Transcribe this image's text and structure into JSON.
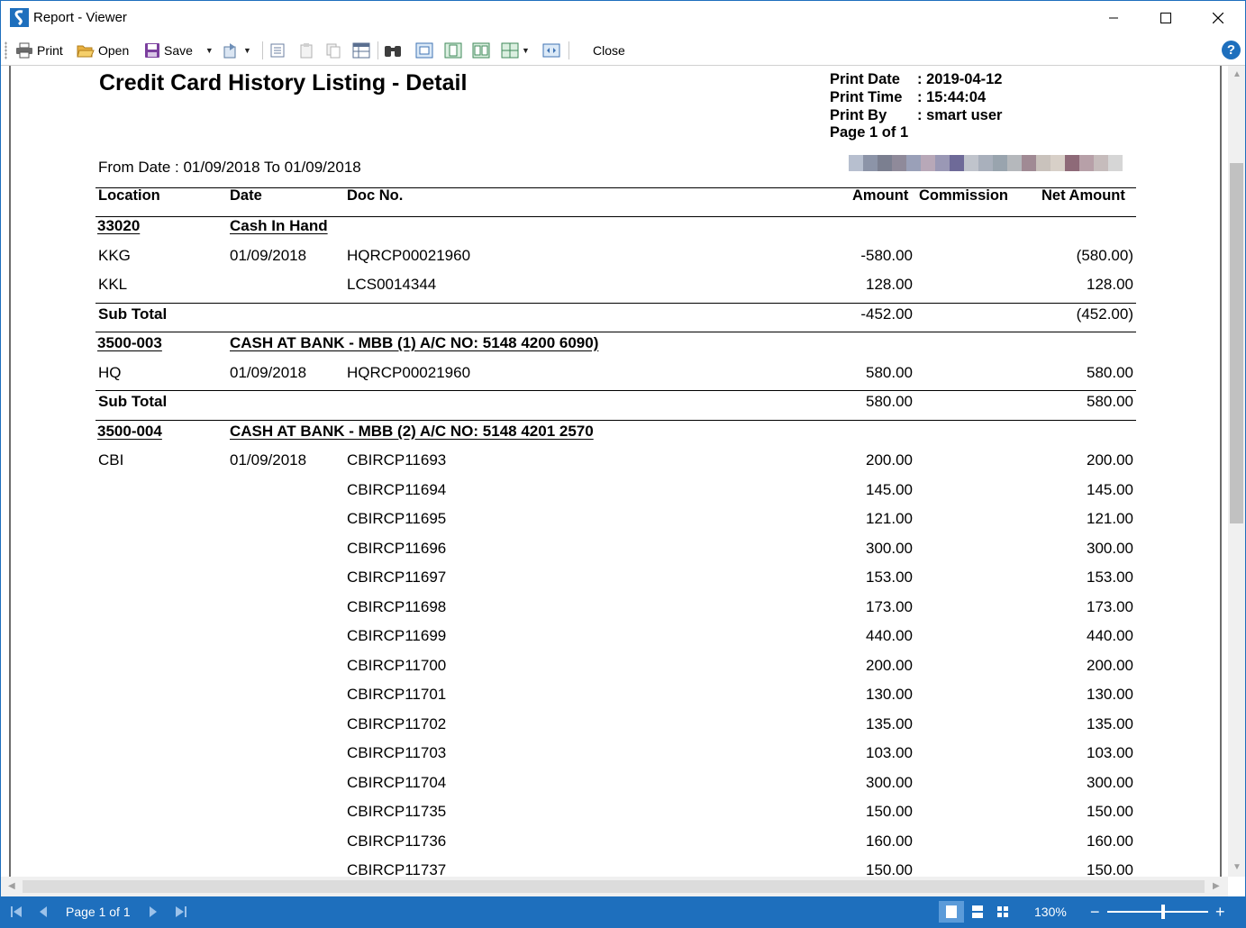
{
  "window": {
    "title": "Report - Viewer"
  },
  "toolbar": {
    "print_label": "Print",
    "open_label": "Open",
    "save_label": "Save",
    "close_label": "Close"
  },
  "report": {
    "title": "Credit Card History Listing - Detail",
    "print_info": [
      {
        "label": "Print Date",
        "value": ": 2019-04-12"
      },
      {
        "label": "Print Time",
        "value": ": 15:44:04"
      },
      {
        "label": "Print By",
        "value": ": smart user"
      },
      {
        "label": "Page 1 of 1",
        "value": ""
      }
    ],
    "date_range": "From Date : 01/09/2018 To 01/09/2018",
    "columns": {
      "location": "Location",
      "date": "Date",
      "doc_no": "Doc No.",
      "amount": "Amount",
      "commission": "Commission",
      "net_amount": "Net Amount"
    },
    "groups": [
      {
        "code": "33020",
        "name": "Cash In Hand",
        "rows": [
          {
            "location": "KKG",
            "date": "01/09/2018",
            "doc_no": "HQRCP00021960",
            "amount": "-580.00",
            "net": "(580.00)"
          },
          {
            "location": "KKL",
            "date": "",
            "doc_no": "LCS0014344",
            "amount": "128.00",
            "net": "128.00"
          }
        ],
        "subtotal": {
          "label": "Sub Total",
          "amount": "-452.00",
          "net": "(452.00)"
        }
      },
      {
        "code": "3500-003",
        "name": "CASH AT BANK - MBB (1) A/C NO: 5148 4200 6090)",
        "rows": [
          {
            "location": "HQ",
            "date": "01/09/2018",
            "doc_no": "HQRCP00021960",
            "amount": "580.00",
            "net": "580.00"
          }
        ],
        "subtotal": {
          "label": "Sub Total",
          "amount": "580.00",
          "net": "580.00"
        }
      },
      {
        "code": "3500-004",
        "name": "CASH AT BANK - MBB (2) A/C NO: 5148 4201 2570",
        "rows": [
          {
            "location": "CBI",
            "date": "01/09/2018",
            "doc_no": "CBIRCP11693",
            "amount": "200.00",
            "net": "200.00"
          },
          {
            "location": "",
            "date": "",
            "doc_no": "CBIRCP11694",
            "amount": "145.00",
            "net": "145.00"
          },
          {
            "location": "",
            "date": "",
            "doc_no": "CBIRCP11695",
            "amount": "121.00",
            "net": "121.00"
          },
          {
            "location": "",
            "date": "",
            "doc_no": "CBIRCP11696",
            "amount": "300.00",
            "net": "300.00"
          },
          {
            "location": "",
            "date": "",
            "doc_no": "CBIRCP11697",
            "amount": "153.00",
            "net": "153.00"
          },
          {
            "location": "",
            "date": "",
            "doc_no": "CBIRCP11698",
            "amount": "173.00",
            "net": "173.00"
          },
          {
            "location": "",
            "date": "",
            "doc_no": "CBIRCP11699",
            "amount": "440.00",
            "net": "440.00"
          },
          {
            "location": "",
            "date": "",
            "doc_no": "CBIRCP11700",
            "amount": "200.00",
            "net": "200.00"
          },
          {
            "location": "",
            "date": "",
            "doc_no": "CBIRCP11701",
            "amount": "130.00",
            "net": "130.00"
          },
          {
            "location": "",
            "date": "",
            "doc_no": "CBIRCP11702",
            "amount": "135.00",
            "net": "135.00"
          },
          {
            "location": "",
            "date": "",
            "doc_no": "CBIRCP11703",
            "amount": "103.00",
            "net": "103.00"
          },
          {
            "location": "",
            "date": "",
            "doc_no": "CBIRCP11704",
            "amount": "300.00",
            "net": "300.00"
          },
          {
            "location": "",
            "date": "",
            "doc_no": "CBIRCP11735",
            "amount": "150.00",
            "net": "150.00"
          },
          {
            "location": "",
            "date": "",
            "doc_no": "CBIRCP11736",
            "amount": "160.00",
            "net": "160.00"
          },
          {
            "location": "",
            "date": "",
            "doc_no": "CBIRCP11737",
            "amount": "150.00",
            "net": "150.00"
          }
        ]
      }
    ],
    "pixel_strip_colors": [
      "#b7bfcf",
      "#8c94a8",
      "#7b7f90",
      "#8f8a9a",
      "#9aa0b8",
      "#b8a8b8",
      "#9a98b5",
      "#6e6a98",
      "#c0c4cc",
      "#a9b0bc",
      "#99a4ae",
      "#b5b8bc",
      "#a08a94",
      "#c9c2bc",
      "#d8d0c8",
      "#8e6a78",
      "#b7a0a8",
      "#c6bcbc",
      "#d6d6d6"
    ]
  },
  "statusbar": {
    "page_label": "Page 1 of 1",
    "zoom_label": "130%",
    "zoom_level_percent": 130
  }
}
